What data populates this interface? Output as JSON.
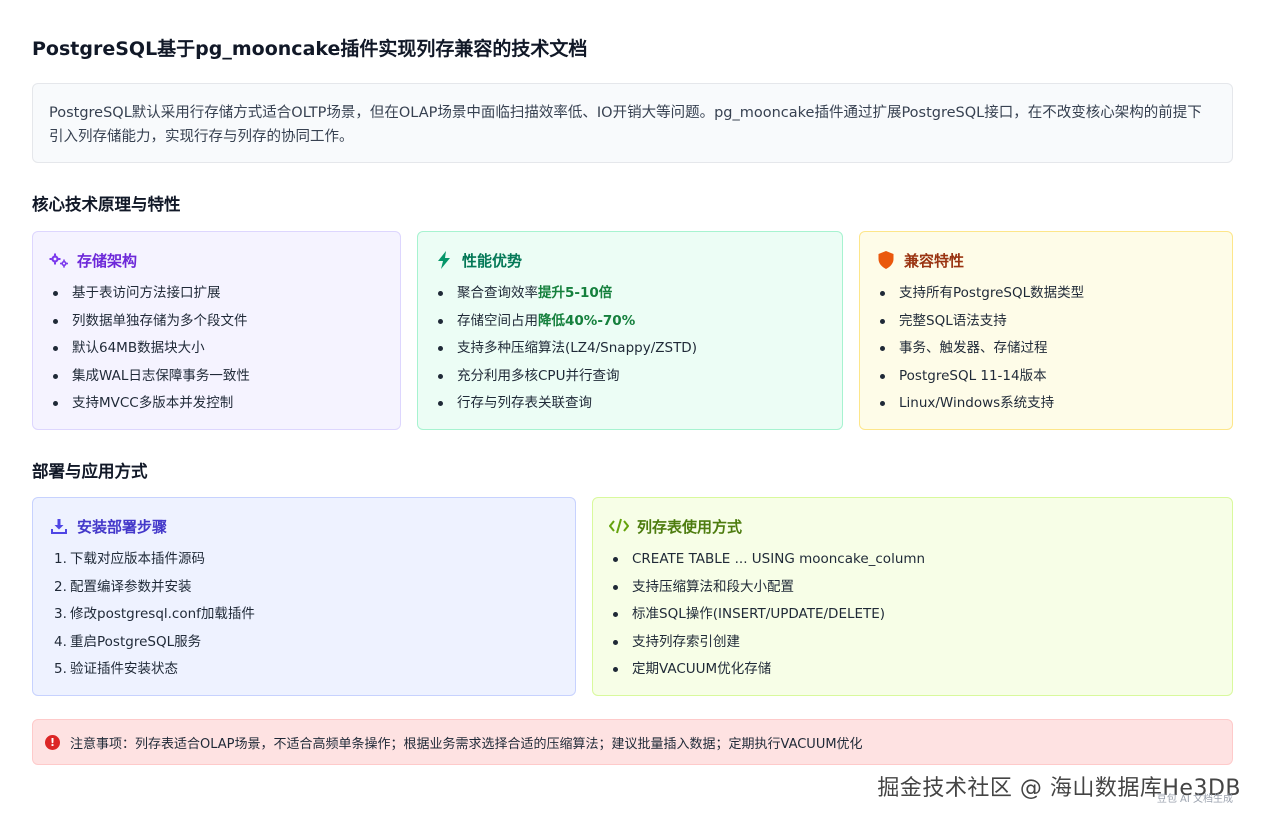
{
  "title": "PostgreSQL基于pg_mooncake插件实现列存兼容的技术文档",
  "intro": "PostgreSQL默认采用行存储方式适合OLTP场景，但在OLAP场景中面临扫描效率低、IO开销大等问题。pg_mooncake插件通过扩展PostgreSQL接口，在不改变核心架构的前提下引入列存储能力，实现行存与列存的协同工作。",
  "section1": {
    "title": "核心技术原理与特性"
  },
  "cards1": [
    {
      "title": "存储架构",
      "icon": "gears-icon",
      "items": [
        {
          "text": "基于表访问方法接口扩展"
        },
        {
          "text": "列数据单独存储为多个段文件"
        },
        {
          "text": "默认64MB数据块大小"
        },
        {
          "text": "集成WAL日志保障事务一致性"
        },
        {
          "text": "支持MVCC多版本并发控制"
        }
      ]
    },
    {
      "title": "性能优势",
      "icon": "lightning-icon",
      "items": [
        {
          "text": "聚合查询效率",
          "highlight": "提升5-10倍"
        },
        {
          "text": "存储空间占用",
          "highlight": "降低40%-70%"
        },
        {
          "text": "支持多种压缩算法(LZ4/Snappy/ZSTD)"
        },
        {
          "text": "充分利用多核CPU并行查询"
        },
        {
          "text": "行存与列存表关联查询"
        }
      ]
    },
    {
      "title": "兼容特性",
      "icon": "shield-icon",
      "items": [
        {
          "text": "支持所有PostgreSQL数据类型"
        },
        {
          "text": "完整SQL语法支持"
        },
        {
          "text": "事务、触发器、存储过程"
        },
        {
          "text": "PostgreSQL 11-14版本"
        },
        {
          "text": "Linux/Windows系统支持"
        }
      ]
    }
  ],
  "section2": {
    "title": "部署与应用方式"
  },
  "cards2": [
    {
      "title": "安装部署步骤",
      "icon": "download-icon",
      "items": [
        {
          "num": "1.",
          "text": "下载对应版本插件源码"
        },
        {
          "num": "2.",
          "text": "配置编译参数并安装"
        },
        {
          "num": "3.",
          "text": "修改postgresql.conf加载插件"
        },
        {
          "num": "4.",
          "text": "重启PostgreSQL服务"
        },
        {
          "num": "5.",
          "text": "验证插件安装状态"
        }
      ]
    },
    {
      "title": "列存表使用方式",
      "icon": "code-icon",
      "items": [
        {
          "text": "CREATE TABLE ... USING mooncake_column"
        },
        {
          "text": "支持压缩算法和段大小配置"
        },
        {
          "text": "标准SQL操作(INSERT/UPDATE/DELETE)"
        },
        {
          "text": "支持列存索引创建"
        },
        {
          "text": "定期VACUUM优化存储"
        }
      ]
    }
  ],
  "notice": "注意事项：列存表适合OLAP场景，不适合高频单条操作；根据业务需求选择合适的压缩算法；建议批量插入数据；定期执行VACUUM优化",
  "watermark": "掘金技术社区 @ 海山数据库He3DB",
  "watermark_sub": "豆包 AI 文档生成",
  "colors": {
    "purple": "#6d28d9",
    "green": "#047857",
    "orange": "#ea580c",
    "indigo": "#4338ca",
    "lime": "#4d7c0f",
    "alert": "#dc2626"
  }
}
